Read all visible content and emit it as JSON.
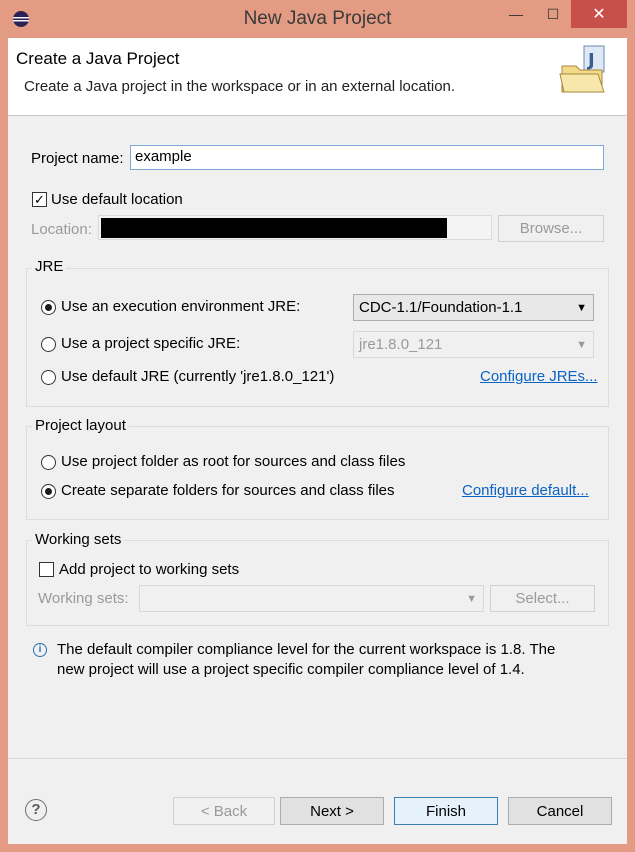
{
  "window": {
    "title": "New Java Project",
    "controls": {
      "minimize": "—",
      "maximize": "☐",
      "close": "✕"
    }
  },
  "banner": {
    "title": "Create a Java Project",
    "description": "Create a Java project in the workspace or in an external location."
  },
  "project": {
    "name_label": "Project name:",
    "name_value": "example"
  },
  "location": {
    "use_default_label": "Use default location",
    "use_default_checked": true,
    "location_label": "Location:",
    "browse_label": "Browse..."
  },
  "jre": {
    "group_label": "JRE",
    "options": [
      {
        "label": "Use an execution environment JRE:",
        "selected": true
      },
      {
        "label": "Use a project specific JRE:",
        "selected": false
      },
      {
        "label": "Use default JRE (currently 'jre1.8.0_121')",
        "selected": false
      }
    ],
    "execution_env_value": "CDC-1.1/Foundation-1.1",
    "project_jre_value": "jre1.8.0_121",
    "configure_link": "Configure JREs..."
  },
  "layout": {
    "group_label": "Project layout",
    "options": [
      {
        "label": "Use project folder as root for sources and class files",
        "selected": false
      },
      {
        "label": "Create separate folders for sources and class files",
        "selected": true
      }
    ],
    "configure_link": "Configure default..."
  },
  "working_sets": {
    "group_label": "Working sets",
    "add_label": "Add project to working sets",
    "add_checked": false,
    "sets_label": "Working sets:",
    "select_label": "Select..."
  },
  "info": {
    "line1": "The default compiler compliance level for the current workspace is 1.8. The",
    "line2": "new project will use a project specific compiler compliance level of 1.4."
  },
  "buttons": {
    "back": "< Back",
    "next": "Next >",
    "finish": "Finish",
    "cancel": "Cancel"
  },
  "icons": {
    "app": "eclipse-icon",
    "banner": "java-project-folder-icon",
    "info": "info-icon",
    "help": "help-icon"
  }
}
